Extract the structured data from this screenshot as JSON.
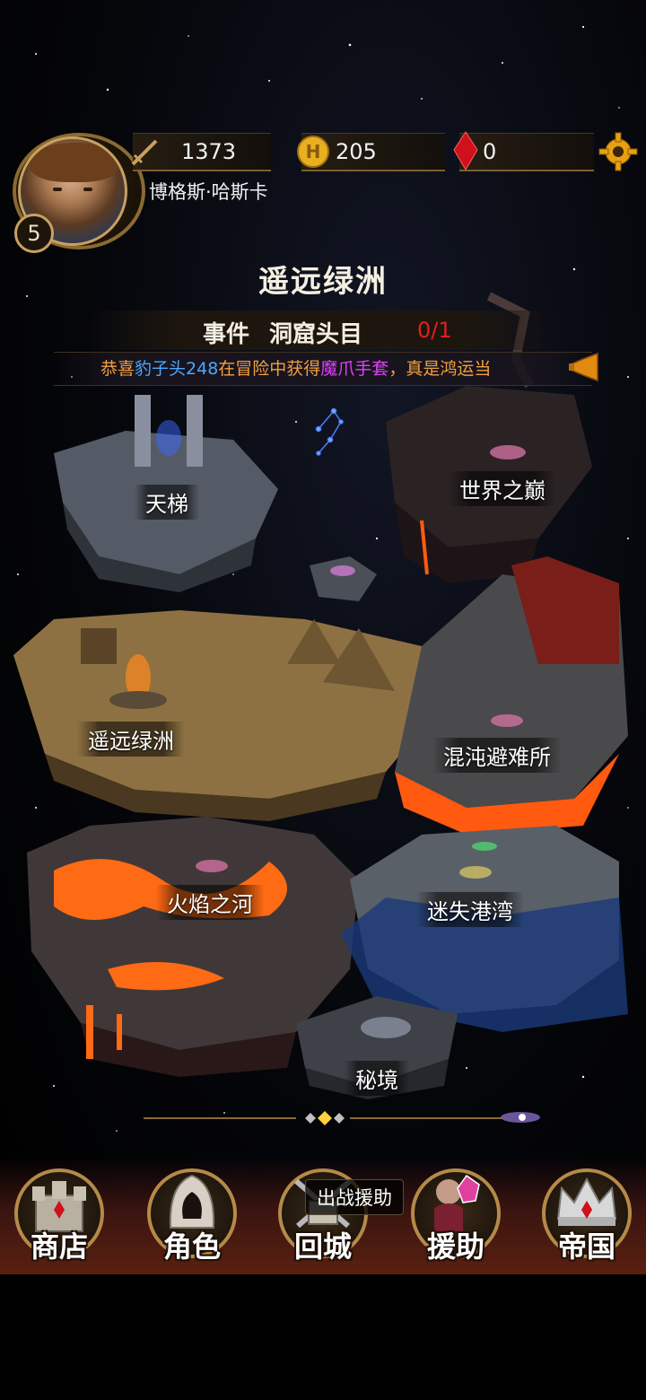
{
  "header": {
    "level": "5",
    "power": "1373",
    "gold": "205",
    "gems": "0",
    "player_name": "博格斯·哈斯卡"
  },
  "location_title": "遥远绿洲",
  "event": {
    "label": "事件",
    "name": "洞窟头目",
    "progress": "0/1"
  },
  "ticker": {
    "prefix": "恭喜",
    "player": "豹子头248",
    "middle": "在冒险中获得",
    "item": "魔爪手套",
    "suffix": "，真是鸿运当"
  },
  "map": {
    "locations": [
      {
        "name": "天梯"
      },
      {
        "name": "世界之巅"
      },
      {
        "name": "遥远绿洲"
      },
      {
        "name": "混沌避难所"
      },
      {
        "name": "火焰之河"
      },
      {
        "name": "迷失港湾"
      },
      {
        "name": "秘境"
      }
    ]
  },
  "nav": {
    "tooltip": "出战援助",
    "items": [
      {
        "label": "商店",
        "icon": "castle-icon"
      },
      {
        "label": "角色",
        "icon": "hooded-figure-icon"
      },
      {
        "label": "回城",
        "icon": "crossed-swords-icon"
      },
      {
        "label": "援助",
        "icon": "ally-icon"
      },
      {
        "label": "帝国",
        "icon": "crown-icon"
      }
    ]
  },
  "colors": {
    "gold": "#c8a060",
    "lava": "#ff6a14",
    "event_progress": "#e02020",
    "ticker_player": "#4aa8ff",
    "ticker_item": "#e040ff"
  }
}
